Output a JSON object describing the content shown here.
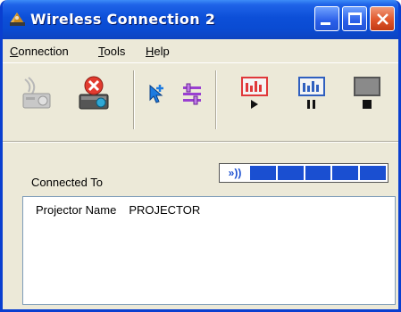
{
  "window": {
    "title": "Wireless Connection 2"
  },
  "titlebar_buttons": [
    "minimize",
    "maximize",
    "close"
  ],
  "menu": [
    {
      "label": "Connection",
      "underline": "C"
    },
    {
      "label": "Tools",
      "underline": "T"
    },
    {
      "label": "Help",
      "underline": "H"
    }
  ],
  "toolbar": {
    "icons": [
      "projector-connect-icon",
      "projector-disconnect-icon",
      "pointer-select-icon",
      "settings-sliders-icon",
      "presentation-play-icon",
      "presentation-pause-icon",
      "presentation-stop-icon"
    ]
  },
  "connection": {
    "label": "Connected To",
    "signal_bars_filled": 5,
    "signal_bars_total": 5,
    "signal_color": "#1a4fd1"
  },
  "info": {
    "key": "Projector Name",
    "value": "PROJECTOR"
  }
}
